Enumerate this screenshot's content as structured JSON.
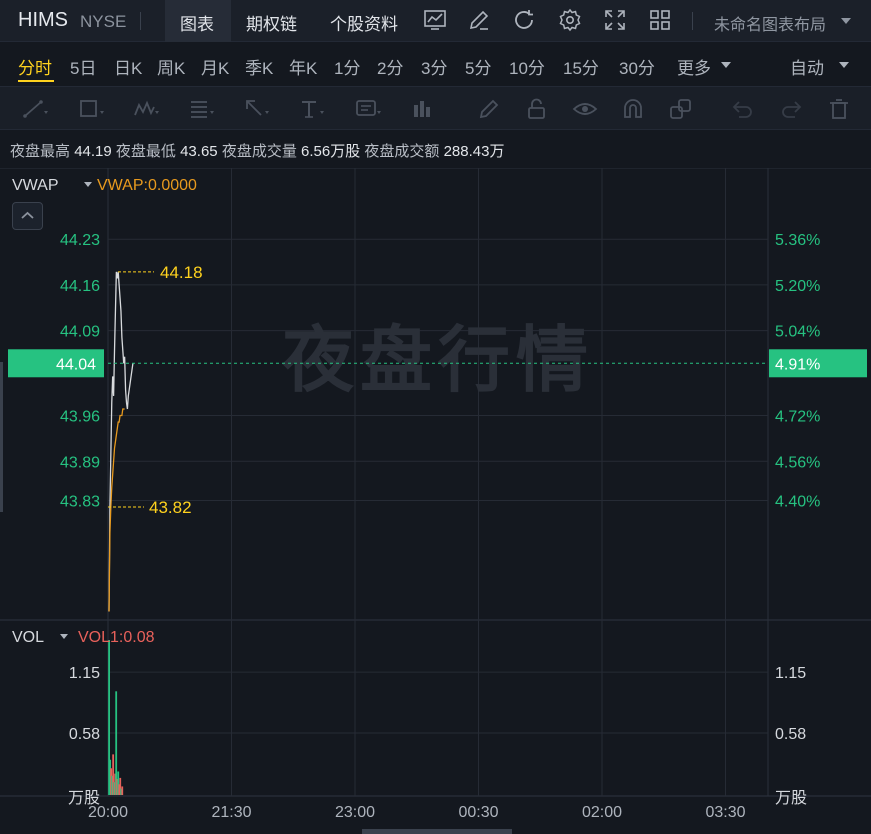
{
  "header": {
    "ticker": "HIMS",
    "exchange": "NYSE",
    "tabs": [
      {
        "label": "图表",
        "active": true
      },
      {
        "label": "期权链",
        "active": false
      },
      {
        "label": "个股资料",
        "active": false
      }
    ],
    "tool_icons": [
      "indicator-chart-icon",
      "pencil-icon",
      "refresh-icon",
      "gear-icon",
      "fullscreen-icon",
      "grid-layout-icon"
    ],
    "layout_name": "未命名图表布局"
  },
  "periods": {
    "items": [
      "分时",
      "5日",
      "日K",
      "周K",
      "月K",
      "季K",
      "年K",
      "1分",
      "2分",
      "3分",
      "5分",
      "10分",
      "15分",
      "30分",
      "更多"
    ],
    "active_index": 0,
    "adjust_label": "自动"
  },
  "drawing_tools": [
    "line-tool-icon",
    "rectangle-tool-icon",
    "pattern-tool-icon",
    "fibonacci-tool-icon",
    "arrow-tool-icon",
    "text-tool-icon",
    "annotation-tool-icon",
    "bars-tool-icon",
    "brush-icon",
    "lock-icon",
    "eye-icon",
    "magnet-icon",
    "layers-icon",
    "undo-icon",
    "redo-icon",
    "trash-icon"
  ],
  "stats": {
    "high_label": "夜盘最高",
    "high_value": "44.19",
    "low_label": "夜盘最低",
    "low_value": "43.65",
    "volume_label": "夜盘成交量",
    "volume_value": "6.56万股",
    "amount_label": "夜盘成交额",
    "amount_value": "288.43万"
  },
  "colors": {
    "up": "#26c281",
    "down": "#e8615b",
    "price_line": "#d8dadd",
    "vwap_line": "#e89a1e",
    "highlight": "#ffd21e",
    "current_price_bg": "#26c281"
  },
  "chart_data": {
    "type": "line",
    "watermark": "夜盘行情",
    "price_panel": {
      "indicator_name": "VWAP",
      "indicator_value_label": "VWAP:0.0000",
      "yticks": [
        44.23,
        44.16,
        44.09,
        43.96,
        43.89,
        43.83
      ],
      "yticks_label": [
        "44.23",
        "44.16",
        "44.09",
        "43.96",
        "43.89",
        "43.83"
      ],
      "ylim": [
        43.65,
        44.29
      ],
      "pct_ticks": [
        "5.36%",
        "5.20%",
        "5.04%",
        "4.72%",
        "4.56%",
        "4.40%"
      ],
      "current_price": "44.04",
      "current_pct": "4.91%",
      "max_label": "44.18",
      "min_label": "43.82",
      "series": [
        {
          "role": "price",
          "x": [
            0,
            1,
            2,
            3,
            4,
            5,
            6,
            7,
            8,
            9,
            10,
            11,
            12,
            13,
            14,
            15,
            16,
            17,
            18,
            19,
            20,
            21,
            22,
            23,
            24,
            25,
            26
          ],
          "values": [
            43.66,
            43.82,
            43.9,
            43.98,
            44.02,
            43.99,
            44.06,
            44.12,
            44.18,
            44.17,
            44.18,
            44.16,
            44.14,
            44.12,
            44.08,
            44.06,
            44.04,
            44.05,
            44.0,
            43.98,
            43.97,
            43.99,
            44.0,
            44.01,
            44.02,
            44.03,
            44.04
          ]
        },
        {
          "role": "vwap",
          "x": [
            0,
            1,
            2,
            3,
            4,
            5,
            6,
            7,
            8,
            9,
            10,
            11,
            12,
            13,
            14,
            15,
            16,
            17
          ],
          "values": [
            43.66,
            43.78,
            43.82,
            43.85,
            43.87,
            43.89,
            43.91,
            43.92,
            43.93,
            43.94,
            43.95,
            43.95,
            43.96,
            43.96,
            43.96,
            43.97,
            43.97,
            43.97
          ]
        }
      ]
    },
    "volume_panel": {
      "indicator_name": "VOL",
      "indicator_value_label": "VOL1:0.08",
      "unit": "万股",
      "yticks": [
        1.15,
        0.58
      ],
      "yticks_label": [
        "1.15",
        "0.58"
      ],
      "ylim": [
        0,
        1.45
      ],
      "bars": [
        {
          "x": 0,
          "value": 1.45,
          "up": true
        },
        {
          "x": 1,
          "value": 0.33,
          "up": true
        },
        {
          "x": 2,
          "value": 0.25,
          "up": false
        },
        {
          "x": 3,
          "value": 0.18,
          "up": true
        },
        {
          "x": 4,
          "value": 0.38,
          "up": false
        },
        {
          "x": 5,
          "value": 0.12,
          "up": true
        },
        {
          "x": 6,
          "value": 0.2,
          "up": false
        },
        {
          "x": 7,
          "value": 0.97,
          "up": true
        },
        {
          "x": 8,
          "value": 0.15,
          "up": false
        },
        {
          "x": 9,
          "value": 0.22,
          "up": true
        },
        {
          "x": 10,
          "value": 0.1,
          "up": false
        },
        {
          "x": 11,
          "value": 0.16,
          "up": false
        },
        {
          "x": 12,
          "value": 0.06,
          "up": true
        },
        {
          "x": 13,
          "value": 0.08,
          "up": false
        }
      ]
    },
    "x_ticks": [
      "20:00",
      "21:30",
      "23:00",
      "00:30",
      "02:00",
      "03:30"
    ],
    "grid": true
  }
}
